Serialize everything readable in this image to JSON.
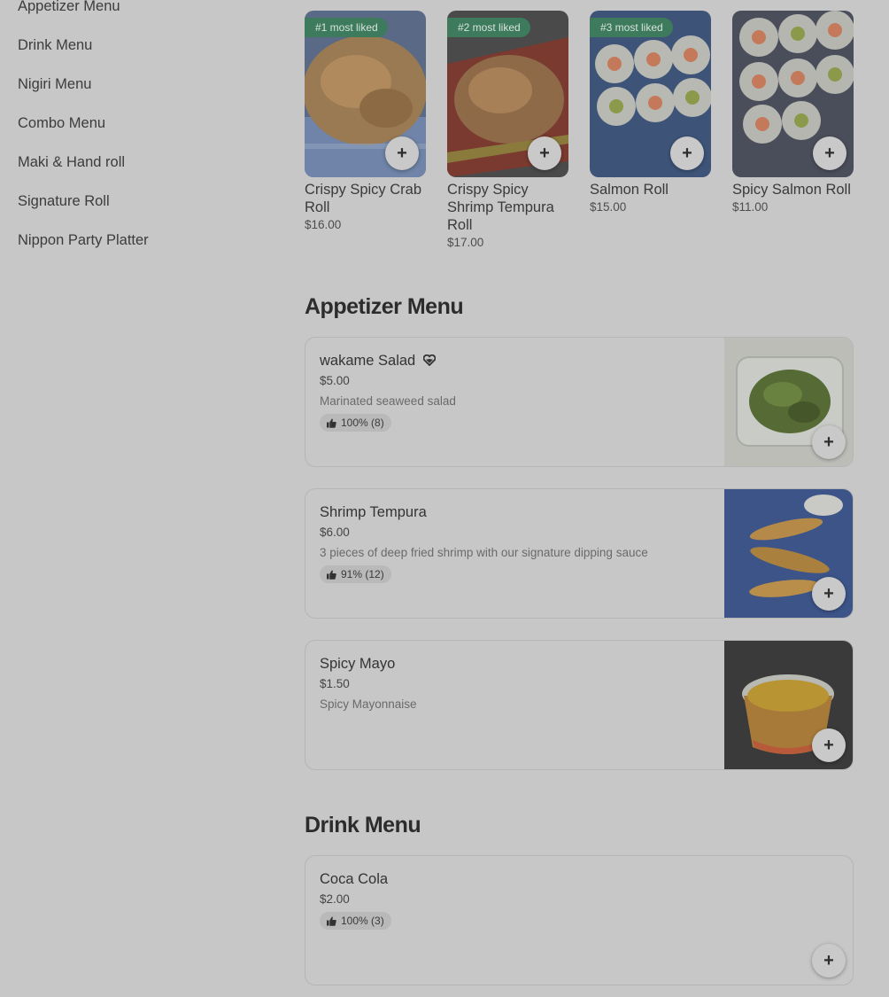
{
  "sidebar": {
    "items": [
      {
        "label": "Appetizer Menu"
      },
      {
        "label": "Drink Menu"
      },
      {
        "label": "Nigiri Menu"
      },
      {
        "label": "Combo Menu"
      },
      {
        "label": "Maki & Hand roll"
      },
      {
        "label": "Signature Roll"
      },
      {
        "label": "Nippon Party Platter"
      }
    ]
  },
  "featured": [
    {
      "badge": "#1 most liked",
      "name": "Crispy Spicy Crab Roll",
      "price": "$16.00"
    },
    {
      "badge": "#2 most liked",
      "name": "Crispy Spicy Shrimp Tempura Roll",
      "price": "$17.00"
    },
    {
      "badge": "#3 most liked",
      "name": "Salmon Roll",
      "price": "$15.00"
    },
    {
      "badge": "",
      "name": "Spicy Salmon Roll",
      "price": "$11.00"
    }
  ],
  "add_label": "+",
  "appetizer": {
    "title": "Appetizer Menu",
    "items": [
      {
        "name": "wakame Salad",
        "price": "$5.00",
        "desc": "Marinated seaweed salad",
        "rating": "100% (8)"
      },
      {
        "name": "Shrimp Tempura",
        "price": "$6.00",
        "desc": "3 pieces of deep fried shrimp with our signature dipping sauce",
        "rating": "91% (12)"
      },
      {
        "name": "Spicy Mayo",
        "price": "$1.50",
        "desc": "Spicy Mayonnaise",
        "rating": ""
      }
    ]
  },
  "drink": {
    "title": "Drink Menu",
    "items": [
      {
        "name": "Coca Cola",
        "price": "$2.00",
        "rating": "100% (3)"
      }
    ]
  },
  "colors": {
    "overlay_bg": "#c7c7c7",
    "badge_green": "#3e7a5c"
  }
}
